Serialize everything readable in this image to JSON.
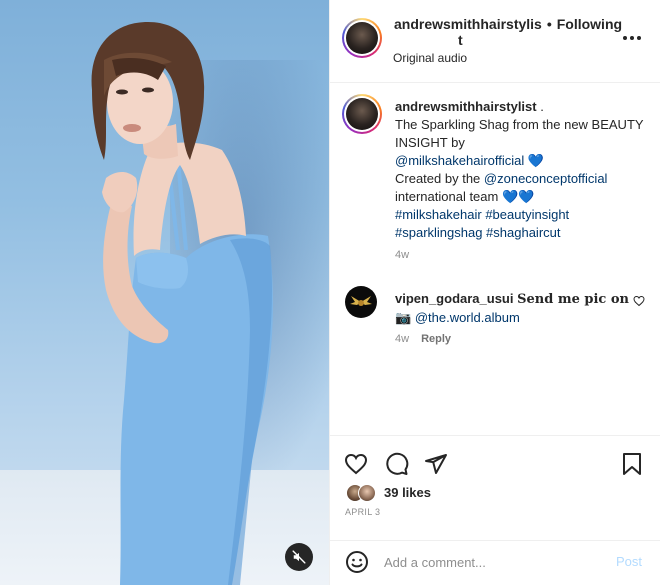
{
  "post": {
    "author": "andrewsmithhairstylist",
    "header_name_part1": "andrewsmithhairstylis",
    "header_name_part2": "t",
    "separator": "•",
    "follow_status": "Following",
    "audio": "Original audio"
  },
  "caption": {
    "username": "andrewsmithhairstylist",
    "username_suffix": " .",
    "line1": "The Sparkling Shag from the new BEAUTY INSIGHT by",
    "mention1": "@milkshakehairofficial",
    "hearts1": "💙",
    "line2": "Created by the",
    "mention2": "@zoneconceptofficial",
    "line3": "international team",
    "hearts2": "💙💙",
    "hashtags": "#milkshakehair #beautyinsight #sparklingshag #shaghaircut",
    "age": "4w"
  },
  "comments": [
    {
      "username": "vipen_godara_usui",
      "text": "Send me pic on",
      "emoji": "📷",
      "mention": "@the.world.album",
      "age": "4w",
      "reply_label": "Reply"
    }
  ],
  "engagement": {
    "likes": "39 likes",
    "date": "APRIL 3"
  },
  "composer": {
    "placeholder": "Add a comment...",
    "post_label": "Post"
  },
  "icons": {
    "mute": "speaker-muted-icon",
    "more": "more-options-icon",
    "like": "heart-icon",
    "comment": "comment-bubble-icon",
    "share": "paper-plane-icon",
    "save": "bookmark-icon",
    "emoji": "smiley-icon"
  },
  "colors": {
    "link": "#00376b",
    "post_disabled": "#b3dbff",
    "muted_text": "#8e8e8e",
    "background_blue": "#93bfe2"
  }
}
